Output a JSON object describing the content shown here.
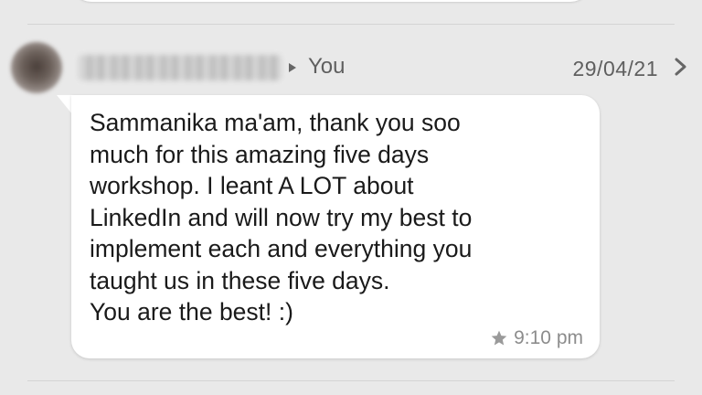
{
  "conversation": {
    "previous_message": {},
    "message": {
      "sender_name": "",
      "recipient": "You",
      "date": "29/04/21",
      "body": "Sammanika ma'am, thank you soo\nmuch for this amazing five days\nworkshop. I leant A LOT about\nLinkedIn and will now try my best to\nimplement each and everything you\ntaught us in these five days.\nYou are the best! :)",
      "time": "9:10 pm",
      "icons": {
        "avatar": "blurred-avatar",
        "direction": "arrow-right-icon",
        "details": "chevron-right-icon",
        "status": "star-icon"
      }
    }
  },
  "colors": {
    "background": "#e9e9e9",
    "bubble": "#ffffff",
    "text": "#1a1a1a",
    "meta_text": "#8c8c8c"
  }
}
